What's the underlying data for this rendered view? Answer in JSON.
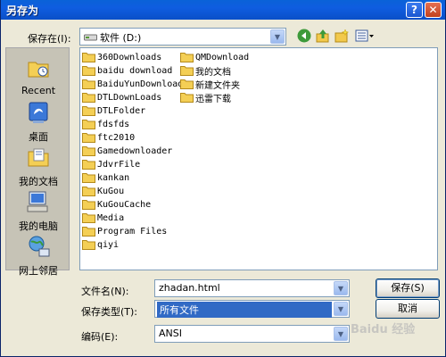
{
  "window": {
    "title": "另存为",
    "help_button": "?",
    "close_button": "✕"
  },
  "location": {
    "label": "保存在(I):",
    "value": "软件 (D:)"
  },
  "places": [
    {
      "label": "Recent",
      "icon": "recent-folder-icon"
    },
    {
      "label": "桌面",
      "icon": "desktop-icon"
    },
    {
      "label": "我的文档",
      "icon": "my-documents-icon"
    },
    {
      "label": "我的电脑",
      "icon": "my-computer-icon"
    },
    {
      "label": "网上邻居",
      "icon": "network-icon"
    }
  ],
  "files": {
    "column1": [
      "360Downloads",
      "baidu download",
      "BaiduYunDownload",
      "DTLDownLoads",
      "DTLFolder",
      "fdsfds",
      "ftc2010",
      "Gamedownloader",
      "JdvrFile",
      "kankan",
      "KuGou",
      "KuGouCache",
      "Media",
      "Program Files",
      "qiyi"
    ],
    "column2": [
      "QMDownload",
      "我的文档",
      "新建文件夹",
      "迅雷下载"
    ]
  },
  "filename": {
    "label": "文件名(N):",
    "value": "zhadan.html"
  },
  "filetype": {
    "label": "保存类型(T):",
    "value": "所有文件"
  },
  "encoding": {
    "label": "编码(E):",
    "value": "ANSI"
  },
  "buttons": {
    "save": "保存(S)",
    "cancel": "取消"
  },
  "watermark": "Baidu 经验",
  "colors": {
    "titlebar": "#0a5ad8",
    "dialog_bg": "#ece9d8",
    "places_bg": "#c6c3b6",
    "selection": "#316ac5"
  }
}
